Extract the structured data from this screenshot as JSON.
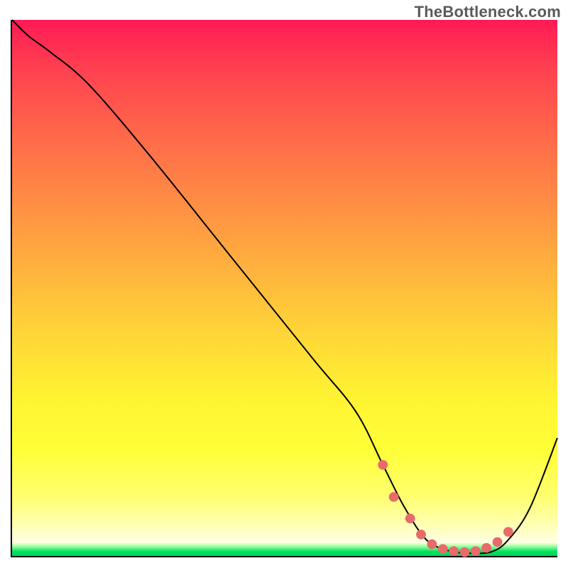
{
  "watermark": "TheBottleneck.com",
  "chart_data": {
    "type": "line",
    "title": "",
    "xlabel": "",
    "ylabel": "",
    "xlim": [
      0,
      100
    ],
    "ylim": [
      0,
      100
    ],
    "grid": false,
    "legend": false,
    "series": [
      {
        "name": "curve",
        "stroke": "#000000",
        "x": [
          0,
          3,
          7,
          14,
          25,
          40,
          55,
          63,
          68,
          72,
          76,
          80,
          84,
          88,
          91,
          95,
          100
        ],
        "values": [
          100,
          97,
          94,
          88,
          75,
          56,
          37,
          27,
          17,
          9,
          3,
          1,
          0.5,
          0.8,
          3,
          9,
          22
        ]
      },
      {
        "name": "markers",
        "type": "scatter",
        "color": "#e86a6a",
        "x": [
          68,
          70,
          73,
          75,
          77,
          79,
          81,
          83,
          85,
          87,
          89,
          91
        ],
        "values": [
          17,
          11,
          7,
          4,
          2.2,
          1.3,
          0.9,
          0.7,
          0.9,
          1.5,
          2.6,
          4.5
        ]
      }
    ],
    "background_gradient": {
      "top": "#ff1a55",
      "mid": "#ffff37",
      "bottom": "#00d858"
    }
  }
}
